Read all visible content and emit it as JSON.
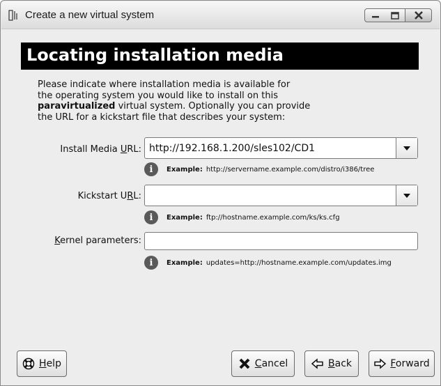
{
  "window": {
    "title": "Create a new virtual system"
  },
  "header": {
    "title": "Locating installation media"
  },
  "intro": {
    "line1": "Please indicate where installation media is available for",
    "line2": "the operating system you would like to install on this",
    "bold_word": "paravirtualized",
    "line3_rest": " virtual system. Optionally you can provide",
    "line4": "the URL for a kickstart file that describes your system:"
  },
  "fields": {
    "install_media": {
      "label_pre": "Install Media ",
      "label_mn": "U",
      "label_post": "RL:",
      "value": "http://192.168.1.200/sles102/CD1",
      "example_label": "Example:",
      "example_text": "http://servername.example.com/distro/i386/tree"
    },
    "kickstart": {
      "label_pre": "Kickstart U",
      "label_mn": "R",
      "label_post": "L:",
      "value": "",
      "example_label": "Example:",
      "example_text": "ftp://hostname.example.com/ks/ks.cfg"
    },
    "kernel": {
      "label_pre": "",
      "label_mn": "K",
      "label_post": "ernel parameters:",
      "value": "",
      "example_label": "Example:",
      "example_text": "updates=http://hostname.example.com/updates.img"
    }
  },
  "buttons": {
    "help": {
      "mn": "H",
      "rest": "elp"
    },
    "cancel": {
      "mn": "C",
      "rest": "ancel"
    },
    "back": {
      "mn": "B",
      "rest": "ack"
    },
    "forward": {
      "mn": "F",
      "rest": "orward"
    }
  },
  "icons": {
    "info": "i"
  }
}
